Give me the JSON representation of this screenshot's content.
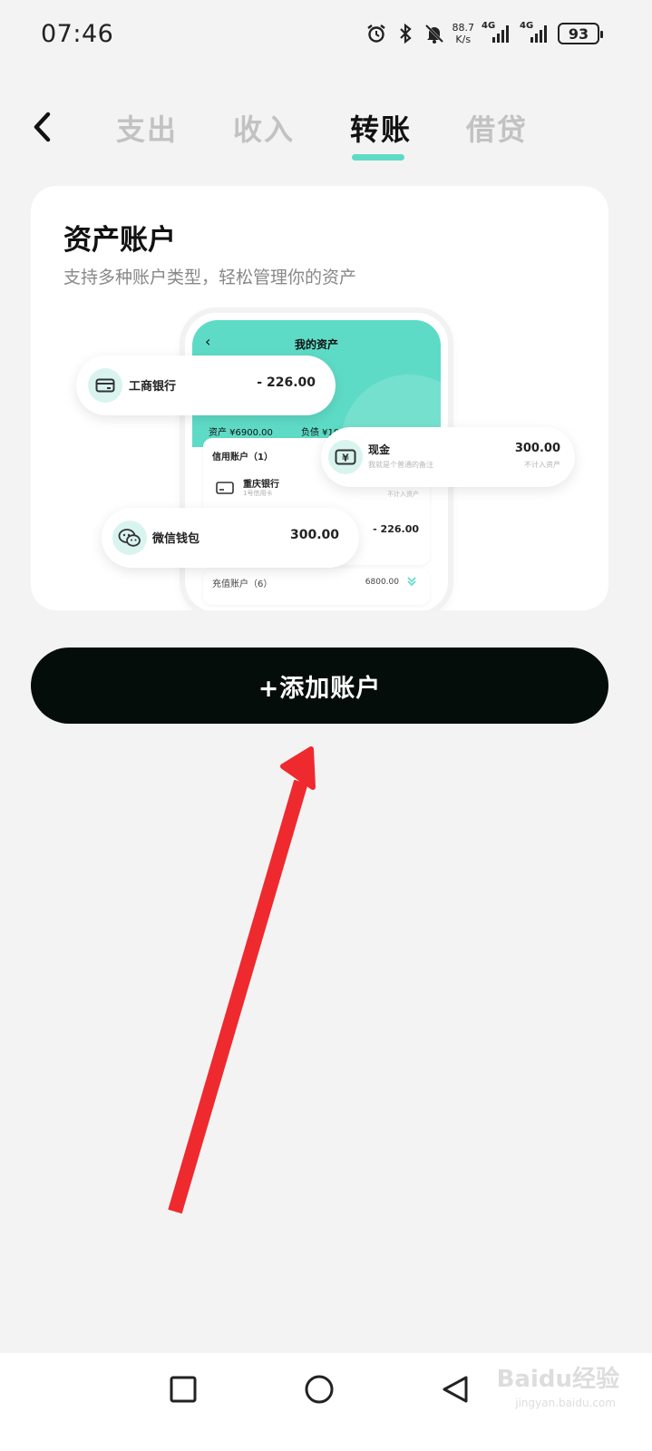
{
  "status_bar": {
    "time": "07:46",
    "net_speed_value": "88.7",
    "net_speed_unit": "K/s",
    "sim1_tag": "4G",
    "sim2_tag": "4G",
    "battery": "93"
  },
  "header": {
    "tabs": [
      {
        "label": "支出",
        "active": false
      },
      {
        "label": "收入",
        "active": false
      },
      {
        "label": "转账",
        "active": true
      },
      {
        "label": "借贷",
        "active": false
      }
    ],
    "accent_color": "#5edbc6"
  },
  "card": {
    "title": "资产账户",
    "subtitle": "支持多种账户类型，轻松管理你的资产",
    "illustration": {
      "phone_title": "我的资产",
      "assets_text": "资产 ¥6900.00",
      "debt_text": "负债 ¥100.00",
      "credit_label": "信用账户（1）",
      "cq_bank_name": "重庆银行",
      "cq_bank_note": "1号信用卡",
      "cq_excluded": "不计入资产",
      "cq_amount": "- 226.00",
      "recharge_label": "充值账户（6）",
      "recharge_amount": "6800.00",
      "pill_icbc": {
        "name": "工商银行",
        "amount": "- 226.00"
      },
      "pill_cash": {
        "name": "现金",
        "note": "我就是个普通的备注",
        "amount": "300.00",
        "note2": "不计入资产"
      },
      "pill_wechat": {
        "name": "微信钱包",
        "amount": "300.00"
      }
    }
  },
  "add_button": {
    "label": "+添加账户"
  },
  "watermark": {
    "text": "Baidu经验",
    "sub": "jingyan.baidu.com"
  },
  "colors": {
    "background": "#f3f3f3",
    "button_bg": "#050d0b",
    "arrow": "#ee2a2f"
  }
}
